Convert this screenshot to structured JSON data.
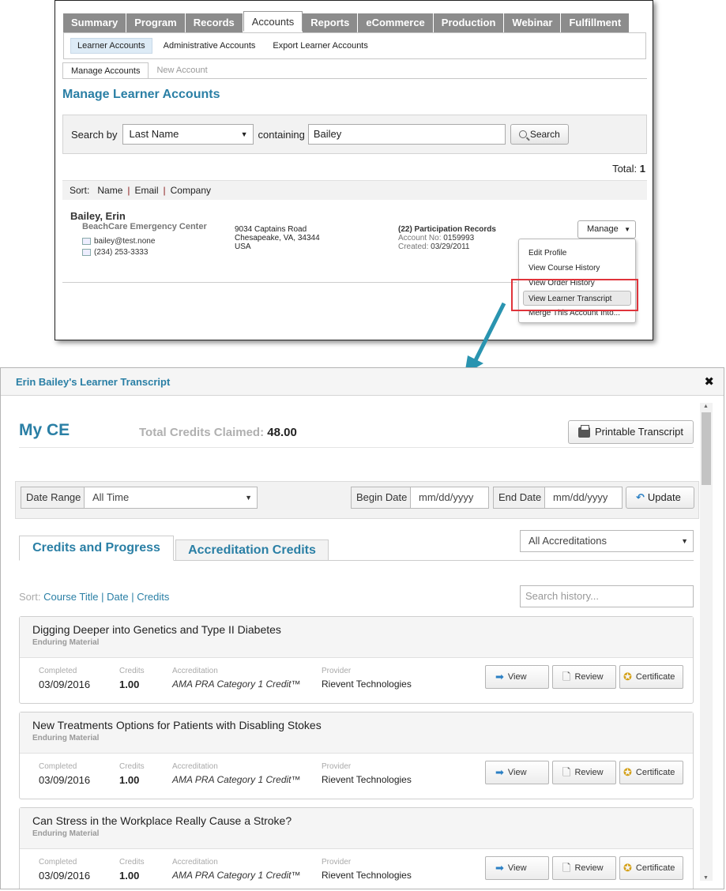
{
  "admin": {
    "main_tabs": [
      "Summary",
      "Program",
      "Records",
      "Accounts",
      "Reports",
      "eCommerce",
      "Production",
      "Webinar",
      "Fulfillment"
    ],
    "active_main_tab": "Accounts",
    "sub_nav": [
      "Learner Accounts",
      "Administrative Accounts",
      "Export Learner Accounts"
    ],
    "page_tabs": [
      "Manage Accounts",
      "New Account"
    ],
    "title": "Manage Learner Accounts",
    "search": {
      "label": "Search by",
      "field_value": "Last Name",
      "containing_label": "containing",
      "query_value": "Bailey",
      "button_label": "Search"
    },
    "total_label": "Total:",
    "total_value": "1",
    "sort": {
      "label": "Sort:",
      "options": [
        "Name",
        "Email",
        "Company"
      ]
    },
    "learner": {
      "name": "Bailey, Erin",
      "company": "BeachCare Emergency Center",
      "email": "bailey@test.none",
      "phone": "(234) 253-3333",
      "address_line1": "9034 Captains Road",
      "address_line2": "Chesapeake, VA, 34344",
      "address_line3": "USA",
      "records": "(22) Participation Records",
      "account_label": "Account No:",
      "account_no": "0159993",
      "created_label": "Created:",
      "created_date": "03/29/2011"
    },
    "manage_button": "Manage",
    "manage_menu": [
      "Edit Profile",
      "View Course History",
      "View Order History",
      "View Learner Transcript",
      "Merge This Account Into..."
    ]
  },
  "modal": {
    "title": "Erin Bailey's Learner Transcript",
    "heading": "My CE",
    "credits_label": "Total Credits Claimed:",
    "credits_value": "48.00",
    "printable_button": "Printable Transcript",
    "filters": {
      "date_range_label": "Date Range",
      "date_range_value": "All Time",
      "begin_label": "Begin Date",
      "begin_placeholder": "mm/dd/yyyy",
      "end_label": "End Date",
      "end_placeholder": "mm/dd/yyyy",
      "update_button": "Update"
    },
    "tabs": [
      "Credits and Progress",
      "Accreditation Credits"
    ],
    "accreditation_filter": "All Accreditations",
    "sort": {
      "label": "Sort:",
      "options": [
        "Course Title",
        "Date",
        "Credits"
      ]
    },
    "history_search_placeholder": "Search history...",
    "column_labels": {
      "completed": "Completed",
      "credits": "Credits",
      "accreditation": "Accreditation",
      "provider": "Provider"
    },
    "card_buttons": {
      "view": "View",
      "review": "Review",
      "certificate": "Certificate"
    },
    "courses": [
      {
        "title": "Digging Deeper into Genetics and Type II Diabetes",
        "type": "Enduring Material",
        "completed": "03/09/2016",
        "credits": "1.00",
        "accreditation": "AMA PRA Category 1 Credit™",
        "provider": "Rievent Technologies"
      },
      {
        "title": "New Treatments Options for Patients with Disabling Stokes",
        "type": "Enduring Material",
        "completed": "03/09/2016",
        "credits": "1.00",
        "accreditation": "AMA PRA Category 1 Credit™",
        "provider": "Rievent Technologies"
      },
      {
        "title": "Can Stress in the Workplace Really Cause a Stroke?",
        "type": "Enduring Material",
        "completed": "03/09/2016",
        "credits": "1.00",
        "accreditation": "AMA PRA Category 1 Credit™",
        "provider": "Rievent Technologies"
      }
    ]
  },
  "colors": {
    "accent": "#2a7fa5",
    "tab_gray": "#8c8c8c",
    "highlight_red": "#e0343b"
  }
}
